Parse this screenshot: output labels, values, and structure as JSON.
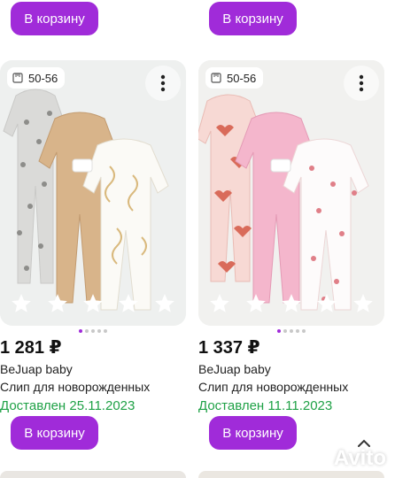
{
  "top_row": {
    "left_button_label": "В корзину",
    "right_button_label": "В корзину"
  },
  "cards": [
    {
      "size": "50-56",
      "price": "1 281 ₽",
      "seller": "BeJuap baby",
      "title": "Слип для новорожденных",
      "delivered": "Доставлен 25.11.2023",
      "button_label": "В корзину",
      "rating_stars": 5,
      "carousel_dots": 5,
      "active_dot": 0
    },
    {
      "size": "50-56",
      "price": "1 337 ₽",
      "seller": "BeJuap baby",
      "title": "Слип для новорожденных",
      "delivered": "Доставлен 11.11.2023",
      "button_label": "В корзину",
      "rating_stars": 5,
      "carousel_dots": 5,
      "active_dot": 0
    }
  ],
  "watermark": {
    "text": "Avito"
  },
  "colors": {
    "accent": "#a02bd9",
    "delivered_green": "#1fa146",
    "price_text": "#111111"
  },
  "icons": {
    "size": "size-ruler-icon",
    "menu": "more-vertical-icon",
    "star": "star-icon",
    "scroll_up": "chevron-up-icon"
  }
}
